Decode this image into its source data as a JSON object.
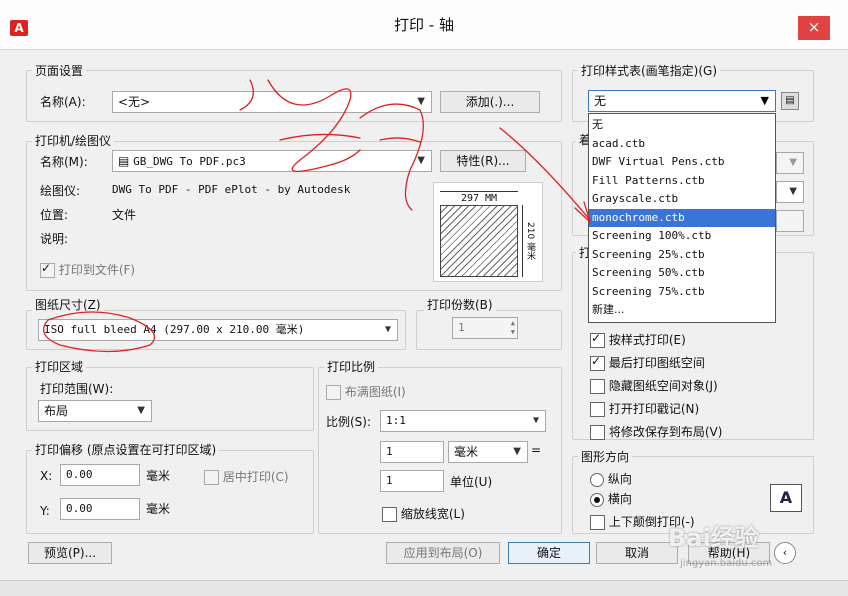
{
  "window": {
    "title": "打印 - 轴",
    "close_label": "×"
  },
  "page_setup": {
    "group_label": "页面设置",
    "name_label": "名称(A):",
    "name_value": "<无>",
    "add_button": "添加(.)..."
  },
  "plotter": {
    "group_label": "打印机/绘图仪",
    "name_label": "名称(M):",
    "name_value": "GB_DWG To PDF.pc3",
    "properties_button": "特性(R)...",
    "plotter_label": "绘图仪:",
    "plotter_value": "DWG To PDF - PDF ePlot - by Autodesk",
    "where_label": "位置:",
    "where_value": "文件",
    "desc_label": "说明:",
    "plot_to_file_label": "打印到文件(F)",
    "preview_width_label": "297 MM",
    "preview_height_label": "210 毫米"
  },
  "paper_size": {
    "group_label": "图纸尺寸(Z)",
    "value": "ISO full bleed A4 (297.00 x 210.00 毫米)"
  },
  "copies": {
    "group_label": "打印份数(B)",
    "value": "1"
  },
  "plot_area": {
    "group_label": "打印区域",
    "what_label": "打印范围(W):",
    "what_value": "布局"
  },
  "plot_offset": {
    "group_label": "打印偏移 (原点设置在可打印区域)",
    "x_label": "X:",
    "x_value": "0.00",
    "x_unit": "毫米",
    "center_label": "居中打印(C)",
    "y_label": "Y:",
    "y_value": "0.00",
    "y_unit": "毫米"
  },
  "plot_scale": {
    "group_label": "打印比例",
    "fit_label": "布满图纸(I)",
    "scale_label": "比例(S):",
    "scale_value": "1:1",
    "value1": "1",
    "unit1": "毫米",
    "equals": "=",
    "value2": "1",
    "unit2": "单位(U)",
    "lineweights_label": "缩放线宽(L)"
  },
  "plot_style_table": {
    "group_label": "打印样式表(画笔指定)(G)",
    "selected": "无",
    "options": [
      "无",
      "acad.ctb",
      "DWF Virtual Pens.ctb",
      "Fill Patterns.ctb",
      "Grayscale.ctb",
      "monochrome.ctb",
      "Screening 100%.ctb",
      "Screening 25%.ctb",
      "Screening 50%.ctb",
      "Screening 75%.ctb",
      "新建..."
    ],
    "highlighted_index": 5
  },
  "shaded_viewport": {
    "group_label_fragment": "着"
  },
  "plot_options": {
    "group_label_fragment": "打",
    "plot_with_styles": "按样式打印(E)",
    "plot_paperspace_last": "最后打印图纸空间",
    "hide_objects": "隐藏图纸空间对象(J)",
    "plot_stamp": "打开打印戳记(N)",
    "save_changes": "将修改保存到布局(V)"
  },
  "orientation": {
    "group_label": "图形方向",
    "portrait": "纵向",
    "landscape": "横向",
    "upside_down": "上下颠倒打印(-)",
    "icon_letter": "A"
  },
  "footer": {
    "preview_button": "预览(P)...",
    "apply_button": "应用到布局(O)",
    "ok_button": "确定",
    "cancel_button": "取消",
    "help_button": "帮助(H)"
  },
  "watermark": {
    "text": "Bai经验",
    "url": "jingyan.baidu.com"
  },
  "colors": {
    "selection": "#3875d7",
    "close": "#e04343",
    "annotation": "#e02020"
  }
}
